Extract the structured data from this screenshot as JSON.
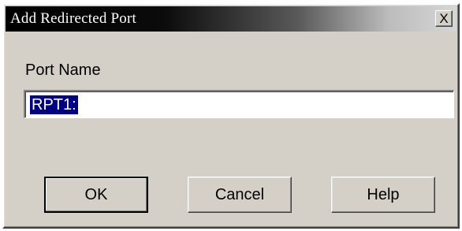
{
  "dialog": {
    "title": "Add Redirected Port",
    "close_icon_glyph": "✕",
    "close_label": "X"
  },
  "form": {
    "port_name_label": "Port Name",
    "port_name_value": "RPT1:"
  },
  "buttons": {
    "ok": "OK",
    "cancel": "Cancel",
    "help": "Help"
  },
  "colors": {
    "face": "#d4d0c8",
    "selection": "#000080",
    "title_start": "#000000",
    "title_end": "#d6d6d6"
  }
}
